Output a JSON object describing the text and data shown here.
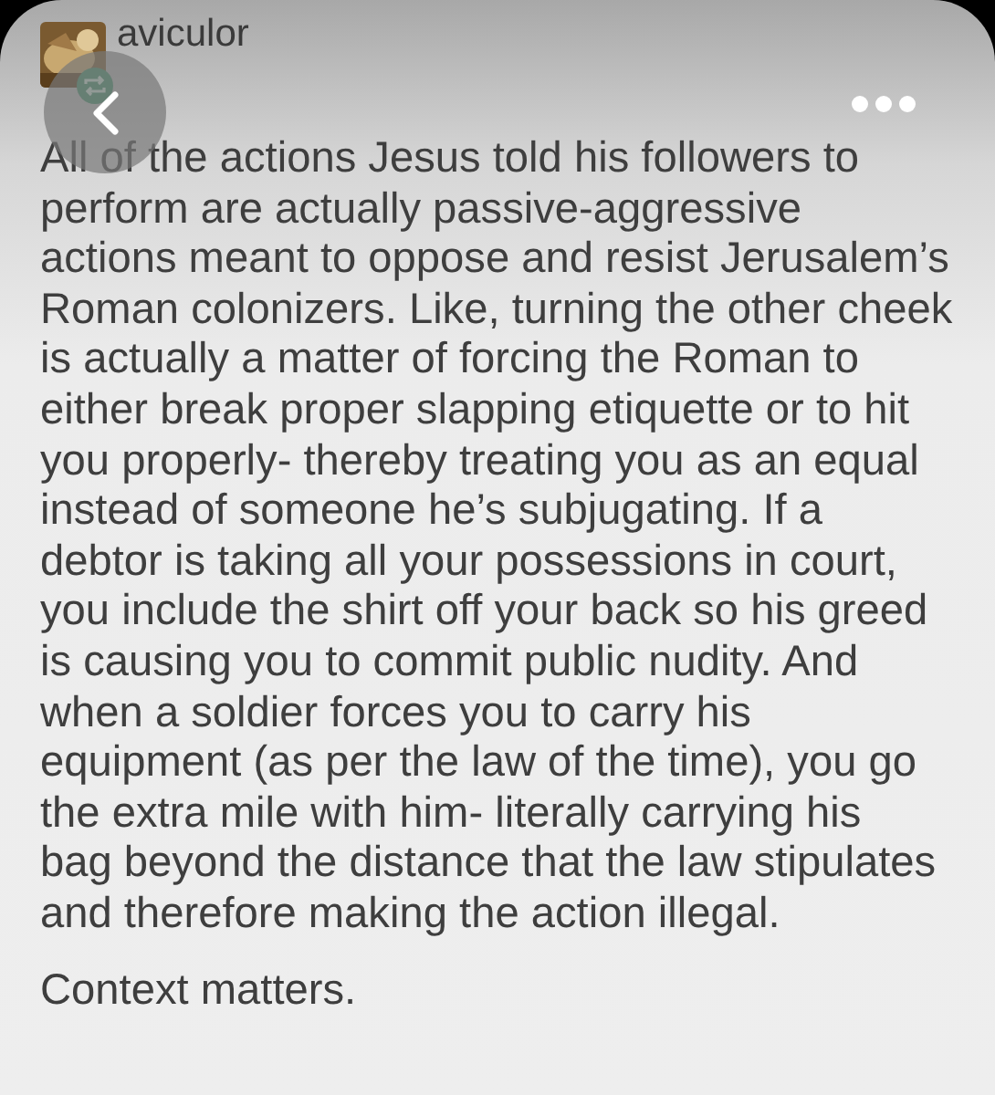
{
  "post": {
    "username": "aviculor",
    "reblogged": true,
    "body": "All of the actions Jesus told his followers to\nperform are actually passive-aggressive\nactions meant to oppose and resist Jerusalem’s\nRoman colonizers. Like, turning the other cheek\nis actually a matter of forcing the Roman to\neither break proper slapping etiquette or to hit\nyou properly- thereby treating you as an equal\ninstead of someone he’s subjugating. If a\ndebtor is taking all your possessions in court,\nyou include the shirt off your back so his greed\nis causing you to commit public nudity. And\nwhen a soldier forces you to carry his\nequipment (as per the law of the time), you go\nthe extra mile with him- literally carrying his\nbag beyond the distance that the law stipulates\nand therefore making the action illegal.",
    "footer": "Context matters."
  }
}
